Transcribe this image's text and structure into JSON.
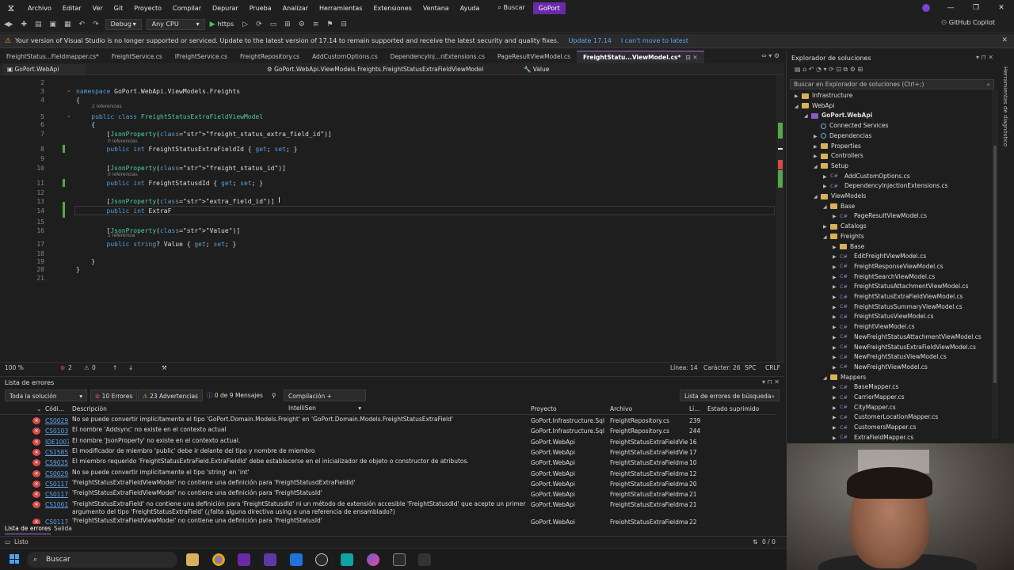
{
  "menubar": {
    "items": [
      "Archivo",
      "Editar",
      "Ver",
      "Git",
      "Proyecto",
      "Compilar",
      "Depurar",
      "Prueba",
      "Analizar",
      "Herramientas",
      "Extensiones",
      "Ventana",
      "Ayuda"
    ],
    "search": "Buscar",
    "project": "GoPort",
    "window_controls": [
      "—",
      "❐",
      "✕"
    ]
  },
  "toolbar": {
    "config": "Debug",
    "platform": "Any CPU",
    "run_target": "https",
    "copilot": "GitHub Copilot"
  },
  "infobar": {
    "message": "Your version of Visual Studio is no longer supported or serviced. Update to the latest version of 17.14 to remain supported and receive the latest security and quality fixes.",
    "update_link": "Update 17.14",
    "cant_link": "I can't move to latest"
  },
  "tabs": [
    {
      "label": "FreightStatus...Fieldmapper.cs*",
      "active": false
    },
    {
      "label": "FreightService.cs",
      "active": false
    },
    {
      "label": "IFreightService.cs",
      "active": false
    },
    {
      "label": "FreightRepository.cs",
      "active": false
    },
    {
      "label": "AddCustomOptions.cs",
      "active": false
    },
    {
      "label": "DependencyInj...nExtensions.cs",
      "active": false
    },
    {
      "label": "PageResultViewModel.cs",
      "active": false
    },
    {
      "label": "FreightStatu...ViewModel.cs*",
      "active": true
    }
  ],
  "navbar": {
    "project": "GoPort.WebApi",
    "type": "GoPort.WebApi.ViewModels.Freights.FreightStatusExtraFieldViewModel",
    "member": "Value"
  },
  "code": {
    "lines": [
      {
        "n": "2",
        "text": ""
      },
      {
        "n": "3",
        "text": "namespace GoPort.WebApi.ViewModels.Freights"
      },
      {
        "n": "4",
        "text": "{"
      },
      {
        "n": "5",
        "text": "    public class FreightStatusExtraFieldViewModel"
      },
      {
        "n": "6",
        "text": "    {"
      },
      {
        "n": "7",
        "text": "        [JsonProperty(\"freight_status_extra_field_id\")]"
      },
      {
        "n": "8",
        "text": "        public int FreightStatusExtraFieldId { get; set; }"
      },
      {
        "n": "9",
        "text": ""
      },
      {
        "n": "10",
        "text": "        [JsonProperty(\"freight_status_id\")]"
      },
      {
        "n": "11",
        "text": "        public int FreightStatusdId { get; set; }"
      },
      {
        "n": "12",
        "text": ""
      },
      {
        "n": "13",
        "text": "        [JsonProperty(\"extra_field_id\")]"
      },
      {
        "n": "14",
        "text": "        public int ExtraF"
      },
      {
        "n": "15",
        "text": ""
      },
      {
        "n": "16",
        "text": "        [JsonProperty(\"Value\")]"
      },
      {
        "n": "17",
        "text": "        public string? Value { get; set; }"
      },
      {
        "n": "18",
        "text": ""
      },
      {
        "n": "19",
        "text": "    }"
      },
      {
        "n": "20",
        "text": "}"
      },
      {
        "n": "21",
        "text": ""
      }
    ],
    "lens_class": "2 referencias",
    "lens_prop1": "0 referencias",
    "lens_prop2": "0 referencias",
    "lens_prop4": "1 referencia"
  },
  "editor_status": {
    "zoom": "100 %",
    "errors": "2",
    "warnings": "0",
    "line": "Línea: 14",
    "char": "Carácter: 26",
    "spc": "SPC",
    "crlf": "CRLF"
  },
  "error_list": {
    "title": "Lista de errores",
    "scope": "Toda la solución",
    "errors_count": "10 Errores",
    "warnings_count": "23 Advertencias",
    "messages_count": "0 de 9 Mensajes",
    "build_filter": "Compilación + IntelliSen",
    "search_placeholder": "Lista de errores de búsqueda",
    "headers": {
      "code": "Códi...",
      "desc": "Descripción",
      "project": "Proyecto",
      "file": "Archivo",
      "line": "Lí...",
      "suppressed": "Estado suprimido"
    },
    "rows": [
      {
        "code": "CS0029",
        "desc": "No se puede convertir implícitamente el tipo 'GoPort.Domain.Models.Freight' en 'GoPort.Domain.Models.FreightStatusExtraField'",
        "project": "GoPort.Infrastructure.Sql",
        "file": "FreightRepository.cs",
        "line": "239"
      },
      {
        "code": "CS0103",
        "desc": "El nombre 'Addsync' no existe en el contexto actual",
        "project": "GoPort.Infrastructure.Sql",
        "file": "FreightRepository.cs",
        "line": "244"
      },
      {
        "code": "IDE1007",
        "desc": "El nombre 'JsonProperty' no existe en el contexto actual.",
        "project": "GoPort.WebApi",
        "file": "FreightStatusExtraFieldVie...",
        "line": "16"
      },
      {
        "code": "CS1585",
        "desc": "El modificador de miembro 'public' debe ir delante del tipo y nombre de miembro",
        "project": "GoPort.WebApi",
        "file": "FreightStatusExtraFieldVie...",
        "line": "17"
      },
      {
        "code": "CS9035",
        "desc": "El miembro requerido 'FreightStatusExtraField.ExtraFieldId' debe establecerse en el inicializador de objeto o constructor de atributos.",
        "project": "GoPort.WebApi",
        "file": "FreightStatusExtraFieldma...",
        "line": "10"
      },
      {
        "code": "CS0029",
        "desc": "No se puede convertir implícitamente el tipo 'string' en 'int'",
        "project": "GoPort.WebApi",
        "file": "FreightStatusExtraFieldma...",
        "line": "12"
      },
      {
        "code": "CS0117",
        "desc": "'FreightStatusExtraFieldViewModel' no contiene una definición para 'FreightStatusdExtraFieldId'",
        "project": "GoPort.WebApi",
        "file": "FreightStatusExtraFieldma...",
        "line": "20"
      },
      {
        "code": "CS0117",
        "desc": "'FreightStatusExtraFieldViewModel' no contiene una definición para 'FreightStatusId'",
        "project": "GoPort.WebApi",
        "file": "FreightStatusExtraFieldma...",
        "line": "21"
      },
      {
        "code": "CS1061",
        "desc": "'FreightStatusExtraField' no contiene una definición para 'FreightStatusdId' ni un método de extensión accesible 'FreightStatusdId' que acepte un primer argumento del tipo 'FreightStatusExtraField' (¿falta alguna directiva using o una referencia de ensamblado?)",
        "project": "GoPort.WebApi",
        "file": "FreightStatusExtraFieldma...",
        "line": "21"
      },
      {
        "code": "CS0117",
        "desc": "'FreightStatusExtraFieldViewModel' no contiene una definición para 'FreightStatusId'",
        "project": "GoPort.WebApi",
        "file": "FreightStatusExtraFieldma...",
        "line": "22"
      }
    ],
    "bottom_tabs": [
      "Lista de errores",
      "Salida"
    ]
  },
  "solution_explorer": {
    "title": "Explorador de soluciones",
    "search_placeholder": "Buscar en Explorador de soluciones (Ctrl+;)",
    "nodes": [
      {
        "label": "Infrastructure",
        "depth": 0,
        "kind": "folder",
        "arrow": "▶"
      },
      {
        "label": "WebApi",
        "depth": 0,
        "kind": "folder",
        "arrow": "◢"
      },
      {
        "label": "GoPort.WebApi",
        "depth": 1,
        "kind": "proj",
        "arrow": "◢",
        "bold": true
      },
      {
        "label": "Connected Services",
        "depth": 2,
        "kind": "svc",
        "arrow": ""
      },
      {
        "label": "Dependencias",
        "depth": 2,
        "kind": "svc",
        "arrow": "▶"
      },
      {
        "label": "Properties",
        "depth": 2,
        "kind": "folder",
        "arrow": "▶"
      },
      {
        "label": "Controllers",
        "depth": 2,
        "kind": "folder",
        "arrow": "▶"
      },
      {
        "label": "Setup",
        "depth": 2,
        "kind": "folder",
        "arrow": "◢"
      },
      {
        "label": "AddCustomOptions.cs",
        "depth": 3,
        "kind": "cs",
        "arrow": "▶"
      },
      {
        "label": "DependencyInjectionExtensions.cs",
        "depth": 3,
        "kind": "cs",
        "arrow": "▶"
      },
      {
        "label": "ViewModels",
        "depth": 2,
        "kind": "folder",
        "arrow": "◢"
      },
      {
        "label": "Base",
        "depth": 3,
        "kind": "folder",
        "arrow": "◢"
      },
      {
        "label": "PageResultViewModel.cs",
        "depth": 4,
        "kind": "cs",
        "arrow": "▶"
      },
      {
        "label": "Catalogs",
        "depth": 3,
        "kind": "folder",
        "arrow": "▶"
      },
      {
        "label": "Freights",
        "depth": 3,
        "kind": "folder",
        "arrow": "◢"
      },
      {
        "label": "Base",
        "depth": 4,
        "kind": "folder",
        "arrow": "▶"
      },
      {
        "label": "EditFreightViewModel.cs",
        "depth": 4,
        "kind": "cs",
        "arrow": "▶"
      },
      {
        "label": "FreightResponseViewModel.cs",
        "depth": 4,
        "kind": "cs",
        "arrow": "▶"
      },
      {
        "label": "FreightSearchViewModel.cs",
        "depth": 4,
        "kind": "cs",
        "arrow": "▶"
      },
      {
        "label": "FreightStatusAttachmentViewModel.cs",
        "depth": 4,
        "kind": "cs",
        "arrow": "▶"
      },
      {
        "label": "FreightStatusExtraFieldViewModel.cs",
        "depth": 4,
        "kind": "cs",
        "arrow": "▶"
      },
      {
        "label": "FreightStatusSummaryViewModel.cs",
        "depth": 4,
        "kind": "cs",
        "arrow": "▶"
      },
      {
        "label": "FreightStatusViewModel.cs",
        "depth": 4,
        "kind": "cs",
        "arrow": "▶"
      },
      {
        "label": "FreightViewModel.cs",
        "depth": 4,
        "kind": "cs",
        "arrow": "▶"
      },
      {
        "label": "NewFreightStatusAttachmentViewModel.cs",
        "depth": 4,
        "kind": "cs",
        "arrow": "▶"
      },
      {
        "label": "NewFreightStatusExtraFieldViewModel.cs",
        "depth": 4,
        "kind": "cs",
        "arrow": "▶"
      },
      {
        "label": "NewFreightStatusViewModel.cs",
        "depth": 4,
        "kind": "cs",
        "arrow": "▶"
      },
      {
        "label": "NewFreightViewModel.cs",
        "depth": 4,
        "kind": "cs",
        "arrow": "▶"
      },
      {
        "label": "Mappers",
        "depth": 3,
        "kind": "folder",
        "arrow": "◢"
      },
      {
        "label": "BaseMapper.cs",
        "depth": 4,
        "kind": "cs",
        "arrow": "▶"
      },
      {
        "label": "CarrierMapper.cs",
        "depth": 4,
        "kind": "cs",
        "arrow": "▶"
      },
      {
        "label": "CityMapper.cs",
        "depth": 4,
        "kind": "cs",
        "arrow": "▶"
      },
      {
        "label": "CustomerLocationMapper.cs",
        "depth": 4,
        "kind": "cs",
        "arrow": "▶"
      },
      {
        "label": "CustomersMapper.cs",
        "depth": 4,
        "kind": "cs",
        "arrow": "▶"
      },
      {
        "label": "ExtraFieldMapper.cs",
        "depth": 4,
        "kind": "cs",
        "arrow": "▶"
      }
    ]
  },
  "side_strip": "Herramientas de diagnóstico",
  "statusbar": {
    "ready": "Listo",
    "position": "0 / 0"
  },
  "taskbar": {
    "search": "Buscar"
  }
}
